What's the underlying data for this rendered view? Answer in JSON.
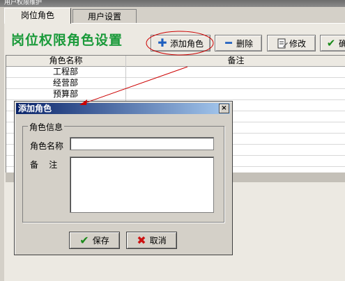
{
  "window": {
    "title": "用户权限维护"
  },
  "tabs": [
    {
      "label": "岗位角色",
      "active": true
    },
    {
      "label": "用户设置",
      "active": false
    }
  ],
  "page": {
    "title": "岗位权限角色设置"
  },
  "toolbar": {
    "add_label": "添加角色",
    "delete_label": "删除",
    "edit_label": "修改",
    "confirm_glyph": "✔",
    "confirm_partial": "确"
  },
  "table": {
    "columns": [
      "角色名称",
      "备注"
    ],
    "rows": [
      {
        "name": "工程部",
        "note": ""
      },
      {
        "name": "经营部",
        "note": ""
      },
      {
        "name": "预算部",
        "note": ""
      }
    ]
  },
  "dialog": {
    "title": "添加角色",
    "close_glyph": "×",
    "group_label": "角色信息",
    "name_label": "角色名称",
    "name_value": "",
    "note_label": "备    注",
    "note_value": "",
    "save_label": "保存",
    "cancel_label": "取消"
  },
  "colors": {
    "title_green": "#1a9a3a",
    "dialog_titlebar": "#0a246a",
    "annotation_red": "#cc0000",
    "add_icon_blue": "#1f5fbf"
  },
  "icons": {
    "add": "plus-icon",
    "delete": "minus-icon",
    "edit": "edit-doc-icon",
    "confirm": "check-icon",
    "save": "check-icon",
    "cancel": "x-icon",
    "close": "close-icon"
  }
}
